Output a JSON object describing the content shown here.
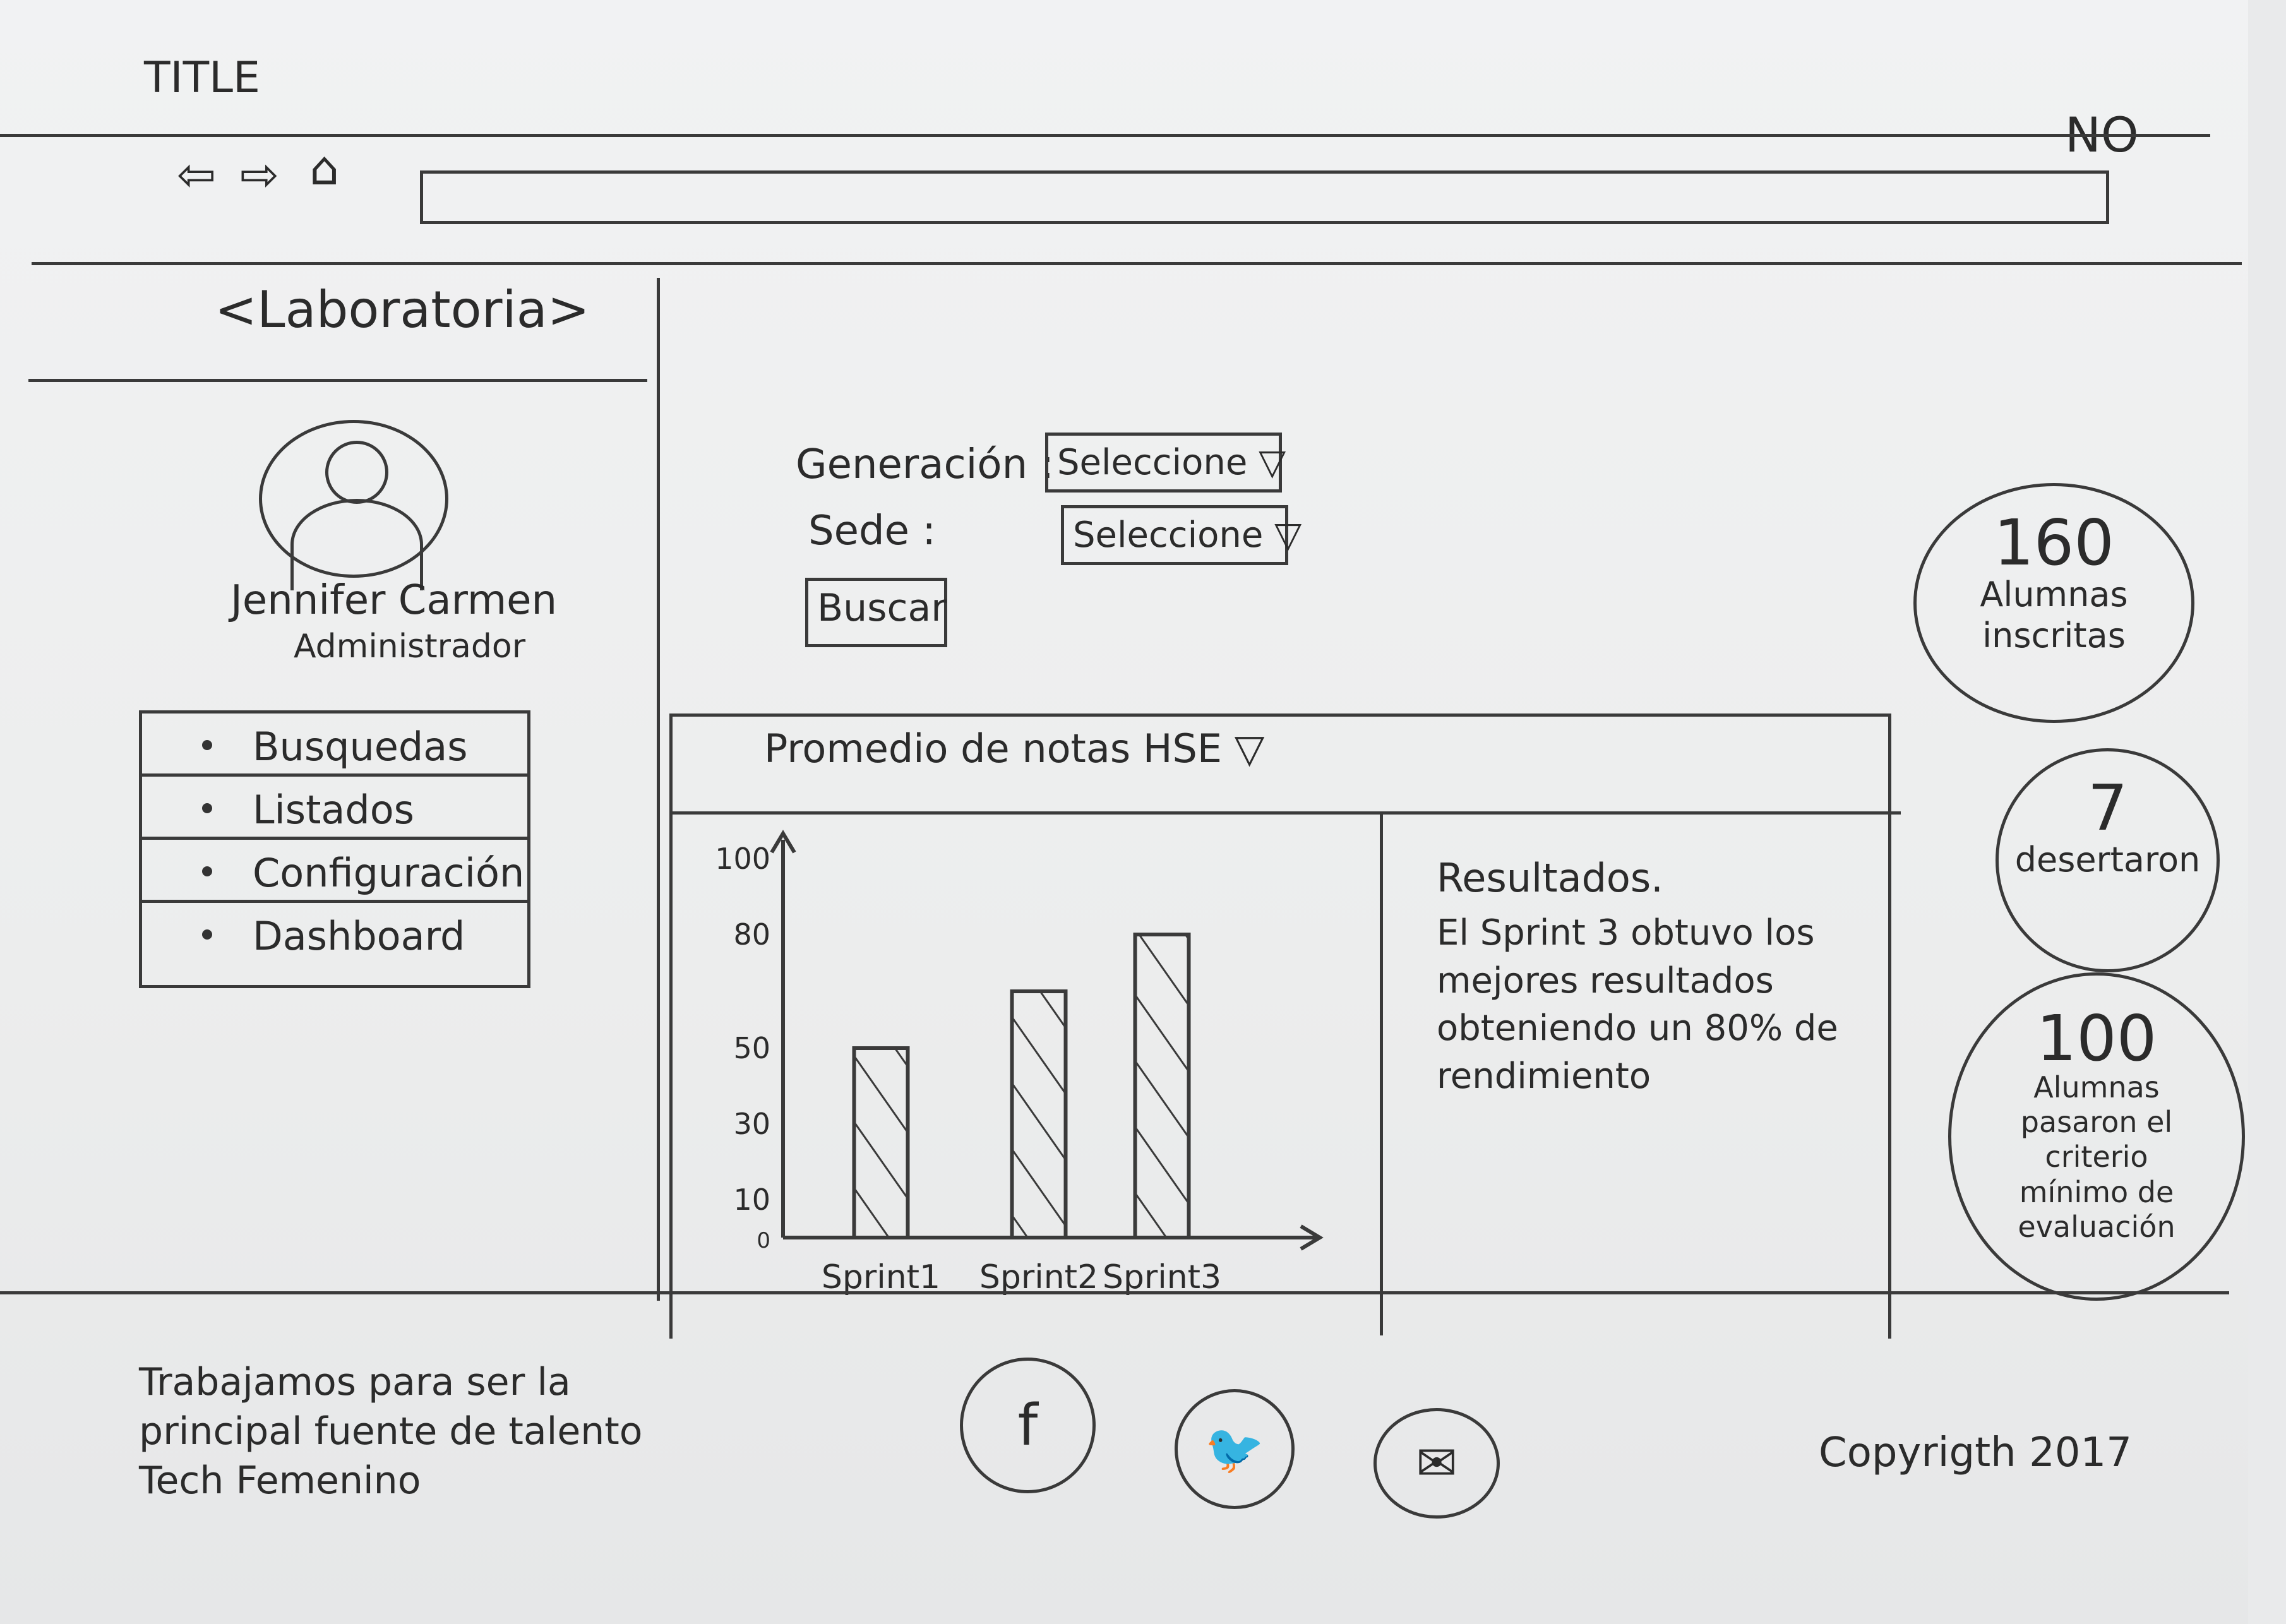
{
  "window": {
    "title": "TITLE",
    "corner_note": "NO"
  },
  "browser": {
    "back_icon": "arrow-left-icon",
    "forward_icon": "arrow-right-icon",
    "home_icon": "home-icon"
  },
  "brand": {
    "logo_text": "<Laboratoria>"
  },
  "user": {
    "name": "Jennifer Carmen",
    "role": "Administrador",
    "avatar_icon": "user-avatar-icon"
  },
  "sidebar": {
    "items": [
      {
        "label": "Busquedas"
      },
      {
        "label": "Listados"
      },
      {
        "label": "Configuración"
      },
      {
        "label": "Dashboard"
      }
    ]
  },
  "filters": {
    "generacion_label": "Generación :",
    "generacion_value": "Seleccione ▽",
    "sede_label": "Sede :",
    "sede_value": "Seleccione ▽",
    "search_button": "Buscar"
  },
  "panel": {
    "title": "Promedio de notas HSE ▽"
  },
  "chart_data": {
    "type": "bar",
    "categories": [
      "Sprint1",
      "Sprint2",
      "Sprint3"
    ],
    "values": [
      50,
      65,
      80
    ],
    "title": "",
    "xlabel": "",
    "ylabel": "",
    "yticks": [
      0,
      10,
      30,
      50,
      80,
      100
    ],
    "ylim": [
      0,
      100
    ],
    "grid": false,
    "hatched": true
  },
  "results": {
    "title": "Resultados.",
    "text": "El Sprint 3 obtuvo los mejores resultados obteniendo un 80% de rendimiento"
  },
  "stats": [
    {
      "number": "160",
      "label": "Alumnas inscritas"
    },
    {
      "number": "7",
      "label": "desertaron"
    },
    {
      "number": "100",
      "label": "Alumnas pasaron el criterio mínimo de evaluación"
    }
  ],
  "footer": {
    "tagline": "Trabajamos para ser la principal fuente de talento Tech Femenino",
    "social": [
      {
        "icon": "facebook-icon",
        "glyph": "f"
      },
      {
        "icon": "twitter-icon",
        "glyph": "🐦"
      },
      {
        "icon": "mail-icon",
        "glyph": "✉"
      }
    ],
    "copyright": "Copyrigth 2017"
  }
}
